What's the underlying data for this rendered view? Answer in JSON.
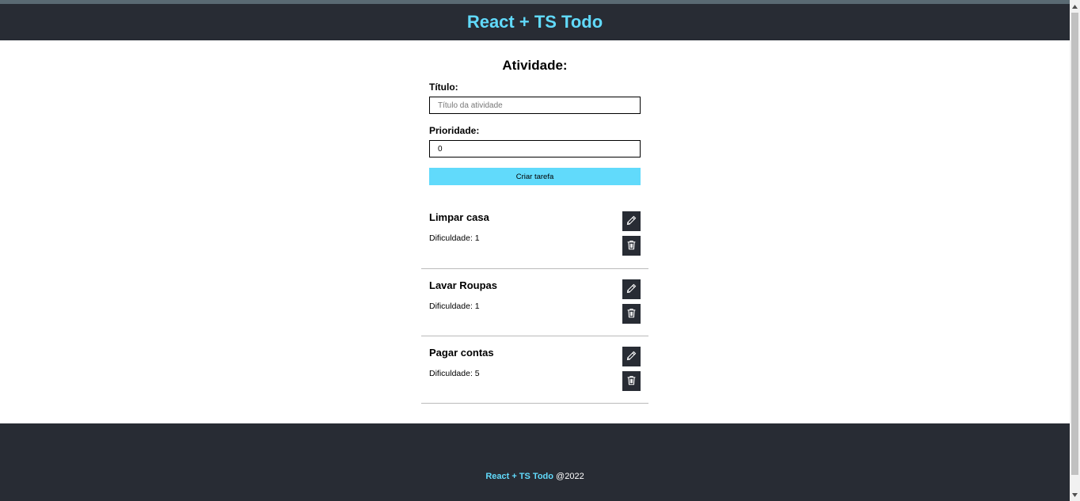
{
  "header": {
    "title": "React + TS Todo"
  },
  "form": {
    "heading": "Atividade:",
    "title_label": "Título:",
    "title_placeholder": "Título da atividade",
    "title_value": "",
    "priority_label": "Prioridade:",
    "priority_value": "0",
    "submit_label": "Criar tarefa"
  },
  "tasks": [
    {
      "title": "Limpar casa",
      "difficulty": "Dificuldade: 1"
    },
    {
      "title": "Lavar Roupas",
      "difficulty": "Dificuldade: 1"
    },
    {
      "title": "Pagar contas",
      "difficulty": "Dificuldade: 5"
    }
  ],
  "footer": {
    "brand": "React + TS Todo",
    "year": "@2022"
  },
  "icons": {
    "edit": "pencil-icon",
    "delete": "trash-icon"
  },
  "colors": {
    "accent": "#61dafb",
    "dark": "#282c34"
  }
}
